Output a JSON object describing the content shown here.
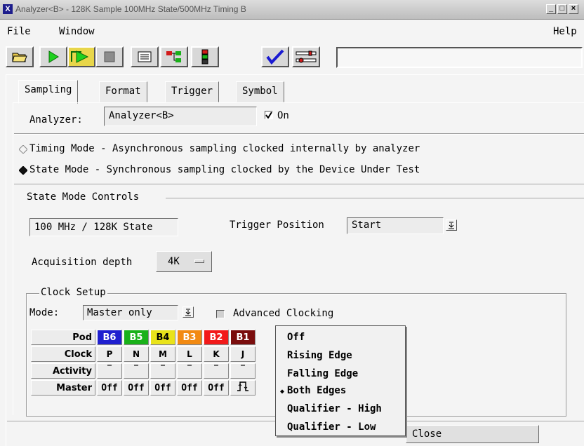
{
  "window": {
    "title": "Analyzer<B> - 128K Sample 100MHz State/500MHz Timing B",
    "icon_letter": "X",
    "controls": {
      "minimize": "_",
      "maximize": "□",
      "close": "×"
    }
  },
  "menubar": {
    "file": "File",
    "window": "Window",
    "help": "Help"
  },
  "toolbar": {
    "icons": [
      "open-folder-icon",
      "run-icon",
      "run-repetitive-icon",
      "stop-icon",
      "listing-icon",
      "overview-icon",
      "setup-icon",
      "checkmark-icon",
      "tools-icon"
    ],
    "field_value": ""
  },
  "tabs": [
    "Sampling",
    "Format",
    "Trigger",
    "Symbol"
  ],
  "active_tab": "Sampling",
  "analyzer": {
    "label": "Analyzer:",
    "name": "Analyzer<B>",
    "on_label": "On",
    "on_checked": true
  },
  "modes": {
    "timing": "Timing Mode  - Asynchronous sampling clocked internally by analyzer",
    "state": "State Mode   - Synchronous sampling clocked by the Device Under Test",
    "selected": "state"
  },
  "state_controls": {
    "title": "State Mode Controls",
    "rate": "100 MHz / 128K State",
    "trigger_position_label": "Trigger Position",
    "trigger_position": "Start",
    "acq_label": "Acquisition depth",
    "acq_value": "4K"
  },
  "clock_setup": {
    "title": "Clock Setup",
    "mode_label": "Mode:",
    "mode_value": "Master only",
    "advanced_label": "Advanced Clocking",
    "row_labels": {
      "pod": "Pod",
      "clock": "Clock",
      "activity": "Activity",
      "master": "Master"
    },
    "pods": [
      {
        "name": "B6",
        "color": "#1f1fcf",
        "clock": "P",
        "activity": "‾",
        "master": "Off"
      },
      {
        "name": "B5",
        "color": "#19b119",
        "clock": "N",
        "activity": "‾",
        "master": "Off"
      },
      {
        "name": "B4",
        "color": "#e9e31a",
        "clock": "M",
        "activity": "‾",
        "master": "Off"
      },
      {
        "name": "B3",
        "color": "#f28a12",
        "clock": "L",
        "activity": "‾",
        "master": "Off"
      },
      {
        "name": "B2",
        "color": "#f21a1a",
        "clock": "K",
        "activity": "‾",
        "master": "Off"
      },
      {
        "name": "B1",
        "color": "#7a0d0d",
        "clock": "J",
        "activity": "‾",
        "master": "both-edges-icon"
      }
    ]
  },
  "popup_menu": {
    "items": [
      "Off",
      "Rising Edge",
      "Falling Edge",
      "Both Edges",
      "Qualifier - High",
      "Qualifier - Low"
    ],
    "selected": "Both Edges"
  },
  "close_label": "Close"
}
